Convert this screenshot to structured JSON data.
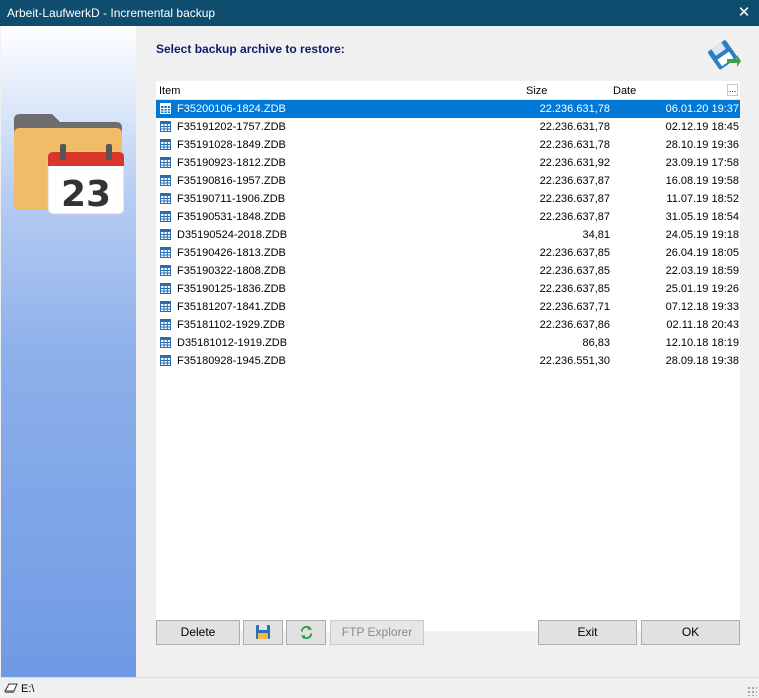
{
  "window": {
    "title": "Arbeit-LaufwerkD - Incremental backup"
  },
  "heading": "Select backup archive to restore:",
  "icons": {
    "folder": "folder-calendar-icon",
    "calendar_day": "23",
    "top": "floppy-restore-icon",
    "file": "grid-file-icon",
    "save": "floppy-icon",
    "refresh": "refresh-icon",
    "drive": "drive-icon"
  },
  "colors": {
    "titlebar": "#0e4d6e",
    "selection": "#0078d7",
    "heading": "#0b1e6b",
    "calendar_red": "#d9352b",
    "folder": "#f0bc68"
  },
  "list": {
    "columns": {
      "item": "Item",
      "size": "Size",
      "date": "Date",
      "menu": "..."
    },
    "rows": [
      {
        "name": "F35200106-1824.ZDB",
        "size": "22.236.631,78",
        "date": "06.01.20 19:37",
        "selected": true
      },
      {
        "name": "F35191202-1757.ZDB",
        "size": "22.236.631,78",
        "date": "02.12.19 18:45"
      },
      {
        "name": "F35191028-1849.ZDB",
        "size": "22.236.631,78",
        "date": "28.10.19 19:36"
      },
      {
        "name": "F35190923-1812.ZDB",
        "size": "22.236.631,92",
        "date": "23.09.19 17:58"
      },
      {
        "name": "F35190816-1957.ZDB",
        "size": "22.236.637,87",
        "date": "16.08.19 19:58"
      },
      {
        "name": "F35190711-1906.ZDB",
        "size": "22.236.637,87",
        "date": "11.07.19 18:52"
      },
      {
        "name": "F35190531-1848.ZDB",
        "size": "22.236.637,87",
        "date": "31.05.19 18:54"
      },
      {
        "name": "D35190524-2018.ZDB",
        "size": "34,81",
        "date": "24.05.19 19:18"
      },
      {
        "name": "F35190426-1813.ZDB",
        "size": "22.236.637,85",
        "date": "26.04.19 18:05"
      },
      {
        "name": "F35190322-1808.ZDB",
        "size": "22.236.637,85",
        "date": "22.03.19 18:59"
      },
      {
        "name": "F35190125-1836.ZDB",
        "size": "22.236.637,85",
        "date": "25.01.19 19:26"
      },
      {
        "name": "F35181207-1841.ZDB",
        "size": "22.236.637,71",
        "date": "07.12.18 19:33"
      },
      {
        "name": "F35181102-1929.ZDB",
        "size": "22.236.637,86",
        "date": "02.11.18 20:43"
      },
      {
        "name": "D35181012-1919.ZDB",
        "size": "86,83",
        "date": "12.10.18 18:19"
      },
      {
        "name": "F35180928-1945.ZDB",
        "size": "22.236.551,30",
        "date": "28.09.18 19:38"
      }
    ]
  },
  "buttons": {
    "delete": "Delete",
    "ftp": "FTP Explorer",
    "exit": "Exit",
    "ok": "OK"
  },
  "status": {
    "drive": "E:\\"
  }
}
